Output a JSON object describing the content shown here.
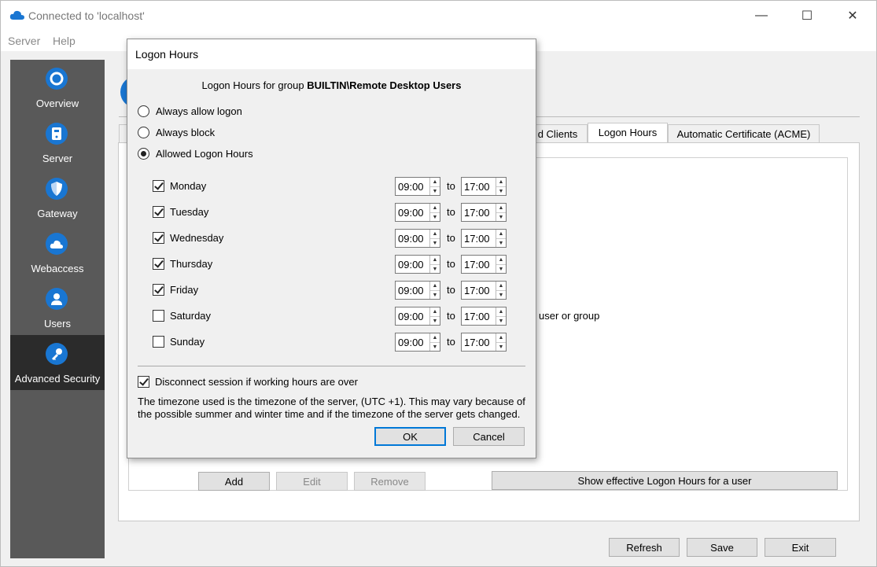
{
  "window": {
    "title": "Connected to 'localhost'",
    "controls": {
      "minimize": "—",
      "maximize": "☐",
      "close": "✕"
    }
  },
  "menu": [
    {
      "label": "Server"
    },
    {
      "label": "Help"
    }
  ],
  "sidebar": {
    "items": [
      {
        "label": "Overview",
        "icon": "overview-icon",
        "active": false
      },
      {
        "label": "Server",
        "icon": "server-icon",
        "active": false
      },
      {
        "label": "Gateway",
        "icon": "gateway-shield-icon",
        "active": false
      },
      {
        "label": "Webaccess",
        "icon": "cloud-icon",
        "active": false
      },
      {
        "label": "Users",
        "icon": "users-icon",
        "active": false
      },
      {
        "label": "Advanced Security",
        "icon": "key-icon",
        "active": true
      }
    ]
  },
  "tabs": [
    {
      "label": "d Clients"
    },
    {
      "label": "Logon Hours",
      "active": true
    },
    {
      "label": "Automatic Certificate (ACME)"
    }
  ],
  "main": {
    "partial_text": "user or group",
    "buttons": {
      "add": "Add",
      "edit": "Edit",
      "remove": "Remove",
      "show_effective": "Show effective Logon Hours for a user"
    }
  },
  "footer": {
    "refresh": "Refresh",
    "save": "Save",
    "exit": "Exit"
  },
  "dialog": {
    "title": "Logon Hours",
    "heading_prefix": "Logon Hours for group ",
    "heading_group": "BUILTIN\\Remote Desktop Users",
    "radios": [
      {
        "label": "Always allow logon",
        "checked": false
      },
      {
        "label": "Always block",
        "checked": false
      },
      {
        "label": "Allowed Logon Hours",
        "checked": true
      }
    ],
    "to_label": "to",
    "days": [
      {
        "name": "Monday",
        "checked": true,
        "from": "09:00",
        "to": "17:00"
      },
      {
        "name": "Tuesday",
        "checked": true,
        "from": "09:00",
        "to": "17:00"
      },
      {
        "name": "Wednesday",
        "checked": true,
        "from": "09:00",
        "to": "17:00"
      },
      {
        "name": "Thursday",
        "checked": true,
        "from": "09:00",
        "to": "17:00"
      },
      {
        "name": "Friday",
        "checked": true,
        "from": "09:00",
        "to": "17:00"
      },
      {
        "name": "Saturday",
        "checked": false,
        "from": "09:00",
        "to": "17:00"
      },
      {
        "name": "Sunday",
        "checked": false,
        "from": "09:00",
        "to": "17:00"
      }
    ],
    "disconnect": {
      "label": "Disconnect session if working hours are over",
      "checked": true
    },
    "note": "The timezone used is the timezone of the server, (UTC +1). This may vary because of the possible summer and winter time and if the timezone of the server gets changed.",
    "ok": "OK",
    "cancel": "Cancel"
  }
}
